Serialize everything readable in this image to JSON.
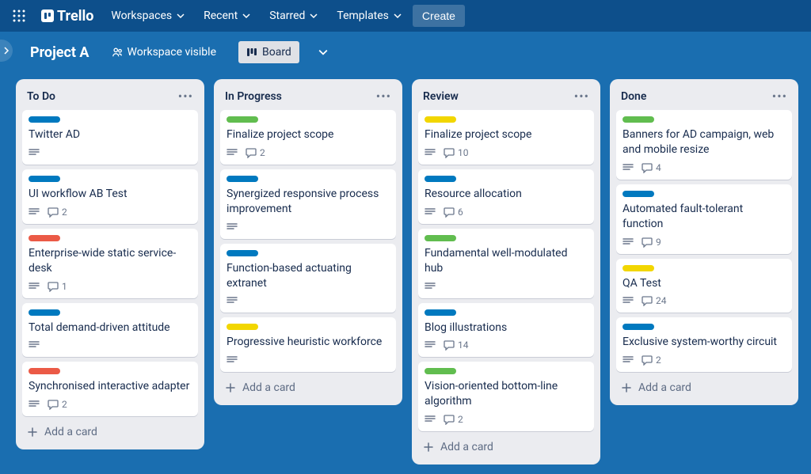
{
  "nav": {
    "brand": "Trello",
    "workspaces": "Workspaces",
    "recent": "Recent",
    "starred": "Starred",
    "templates": "Templates",
    "create": "Create"
  },
  "board": {
    "title": "Project A",
    "workspace_visible": "Workspace visible",
    "board_view": "Board"
  },
  "add_card_label": "Add a card",
  "lists": [
    {
      "title": "To Do",
      "cards": [
        {
          "label": "blue",
          "title": "Twitter AD",
          "comments": null
        },
        {
          "label": "blue",
          "title": "UI workflow AB Test",
          "comments": 2
        },
        {
          "label": "red",
          "title": "Enterprise-wide static service-desk",
          "comments": 1
        },
        {
          "label": "blue",
          "title": "Total demand-driven attitude",
          "comments": null
        },
        {
          "label": "red",
          "title": "Synchronised interactive adapter",
          "comments": 2
        }
      ]
    },
    {
      "title": "In Progress",
      "cards": [
        {
          "label": "green",
          "title": "Finalize project scope",
          "comments": 2
        },
        {
          "label": "blue",
          "title": "Synergized responsive process improvement",
          "comments": null
        },
        {
          "label": "blue",
          "title": "Function-based actuating extranet",
          "comments": null
        },
        {
          "label": "yellow",
          "title": "Progressive heuristic workforce",
          "comments": null
        }
      ]
    },
    {
      "title": "Review",
      "cards": [
        {
          "label": "yellow",
          "title": "Finalize project scope",
          "comments": 10
        },
        {
          "label": "blue",
          "title": "Resource allocation",
          "comments": 6
        },
        {
          "label": "green",
          "title": "Fundamental well-modulated hub",
          "comments": null
        },
        {
          "label": "blue",
          "title": "Blog illustrations",
          "comments": 14
        },
        {
          "label": "green",
          "title": "Vision-oriented bottom-line algorithm",
          "comments": 2
        }
      ]
    },
    {
      "title": "Done",
      "cards": [
        {
          "label": "green",
          "title": "Banners for AD campaign, web and mobile resize",
          "comments": 4
        },
        {
          "label": "blue",
          "title": "Automated fault-tolerant function",
          "comments": 9
        },
        {
          "label": "yellow",
          "title": "QA Test",
          "comments": 24
        },
        {
          "label": "blue",
          "title": "Exclusive system-worthy circuit",
          "comments": 2
        }
      ]
    }
  ]
}
